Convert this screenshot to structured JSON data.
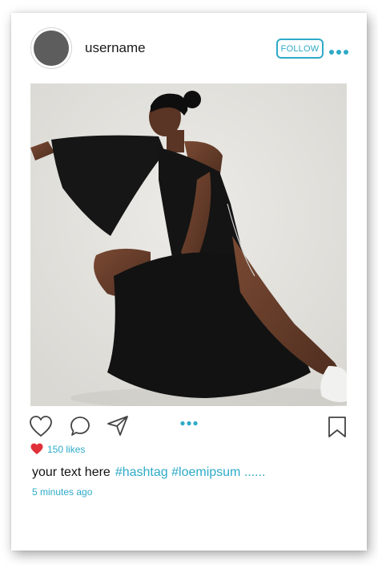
{
  "post": {
    "username": "username",
    "follow_label": "FOLLOW",
    "more_icon": "more-dots-icon",
    "image_subject": "photo"
  },
  "actions": {
    "like_icon": "heart-outline-icon",
    "comment_icon": "comment-bubble-icon",
    "share_icon": "paper-plane-icon",
    "more_icon": "more-dots-icon",
    "save_icon": "bookmark-icon"
  },
  "engagement": {
    "likes_text": "150 likes",
    "liked_icon": "heart-filled-icon"
  },
  "caption": {
    "text": "your text here",
    "hashtags": "#hashtag #loemipsum ......",
    "time_ago": "5 minutes ago"
  },
  "colors": {
    "accent": "#2eaac8",
    "heart": "#e0303a",
    "avatar": "#5d5d5d",
    "icon_stroke": "#444444"
  }
}
